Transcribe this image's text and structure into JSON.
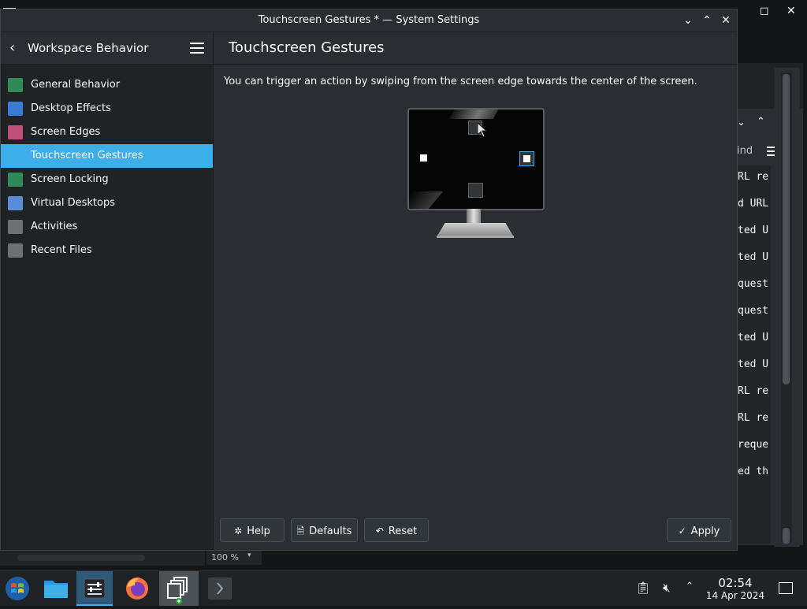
{
  "window": {
    "title": "Touchscreen Gestures * — System Settings",
    "controls": [
      "minimize",
      "maximize",
      "close"
    ]
  },
  "sidebar": {
    "back_label": "Workspace Behavior",
    "items": [
      {
        "label": "General Behavior",
        "icon": "general-behavior-icon",
        "color": "#2e8b57"
      },
      {
        "label": "Desktop Effects",
        "icon": "desktop-effects-icon",
        "color": "#3a7bd5"
      },
      {
        "label": "Screen Edges",
        "icon": "screen-edges-icon",
        "color": "#c0507a"
      },
      {
        "label": "Touchscreen Gestures",
        "icon": "touchscreen-icon",
        "color": "#3daee9",
        "selected": true
      },
      {
        "label": "Screen Locking",
        "icon": "screen-locking-icon",
        "color": "#2e8b57"
      },
      {
        "label": "Virtual Desktops",
        "icon": "virtual-desktops-icon",
        "color": "#5b8dd6"
      },
      {
        "label": "Activities",
        "icon": "activities-icon",
        "color": "#6c7177"
      },
      {
        "label": "Recent Files",
        "icon": "recent-files-icon",
        "color": "#6c7177"
      }
    ]
  },
  "content": {
    "title": "Touchscreen Gestures",
    "description": "You can trigger an action by swiping from the screen edge towards the center of the screen."
  },
  "footer": {
    "help": "Help",
    "defaults": "Defaults",
    "reset": "Reset",
    "apply": "Apply"
  },
  "background": {
    "terminal_lines": [
      "RL re",
      "d URL",
      "ted U",
      "ted U",
      "quest",
      "quest",
      "ted U",
      "ted U",
      "RL re",
      "RL re",
      "reque",
      "ed th"
    ],
    "find_label": "ind",
    "zoom": "100 %"
  },
  "taskbar": {
    "time": "02:54",
    "date": "14 Apr 2024"
  },
  "colors": {
    "accent": "#3daee9",
    "window_bg": "#2a2e32",
    "sidebar_bg": "#202326"
  }
}
